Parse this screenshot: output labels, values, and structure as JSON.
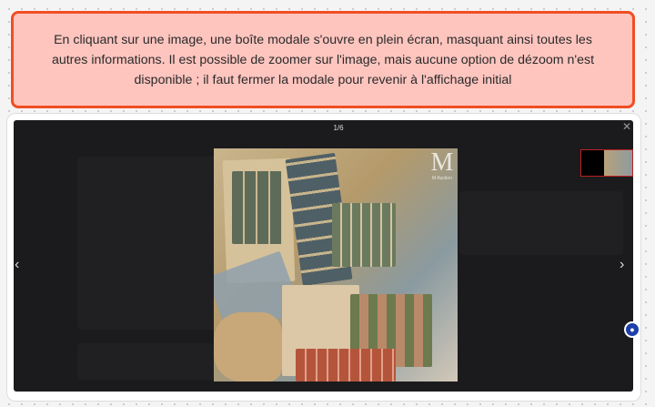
{
  "annotation": {
    "text": "En cliquant sur une image, une boîte modale s'ouvre en plein écran, masquant ainsi toutes les autres informations. Il est possible de zoomer sur l'image, mais aucune option de dézoom n'est disponible ; il faut fermer la modale pour revenir à l'affichage initial"
  },
  "lightbox": {
    "counter": "1/6",
    "close_icon": "close-icon",
    "prev_icon": "chevron-left-icon",
    "next_icon": "chevron-right-icon",
    "watermark": "M Auction",
    "colors": {
      "annotation_bg": "#fec5bf",
      "annotation_border": "#f04e23",
      "modal_bg": "#1b1b1d",
      "thumb_active_border": "#b22222"
    }
  }
}
